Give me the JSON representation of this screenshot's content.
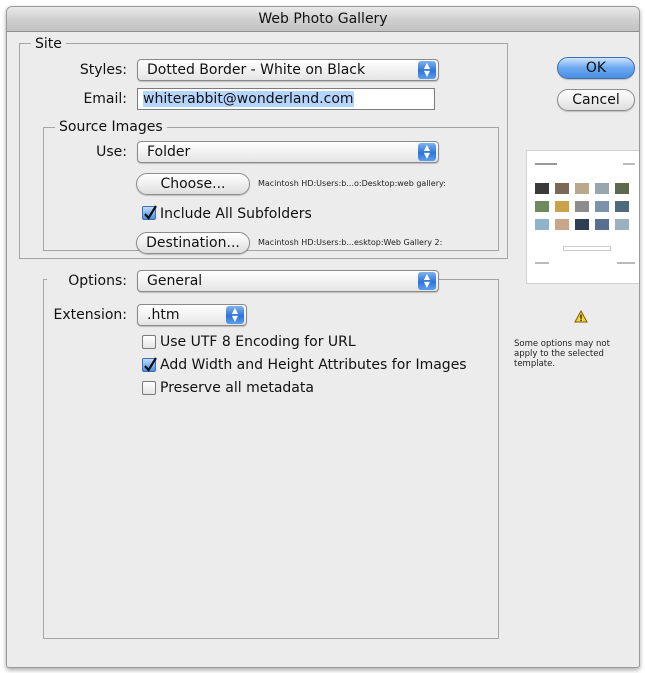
{
  "window": {
    "title": "Web Photo Gallery"
  },
  "site": {
    "legend": "Site",
    "styles_label": "Styles:",
    "styles_value": "Dotted Border - White on Black",
    "email_label": "Email:",
    "email_value": "whiterabbit@wonderland.com"
  },
  "source": {
    "legend": "Source Images",
    "use_label": "Use:",
    "use_value": "Folder",
    "choose_label": "Choose...",
    "choose_path": "Macintosh HD:Users:b...o:Desktop:web gallery:",
    "include_subfolders_label": "Include All Subfolders",
    "include_subfolders_checked": true,
    "destination_label": "Destination...",
    "destination_path": "Macintosh HD:Users:b...esktop:Web Gallery 2:"
  },
  "options": {
    "label": "Options:",
    "value": "General",
    "extension_label": "Extension:",
    "extension_value": ".htm",
    "checkboxes": [
      {
        "label": "Use UTF 8 Encoding for URL",
        "checked": false
      },
      {
        "label": "Add Width and Height Attributes for Images",
        "checked": true
      },
      {
        "label": "Preserve all metadata",
        "checked": false
      }
    ]
  },
  "buttons": {
    "ok": "OK",
    "cancel": "Cancel"
  },
  "preview": {
    "warning_icon": "warning-triangle-icon",
    "note": "Some options may not apply to the selected template."
  },
  "colors": {
    "accent": "#4a8fe6",
    "selection": "#b5d5ff",
    "window_bg": "#ececec"
  }
}
